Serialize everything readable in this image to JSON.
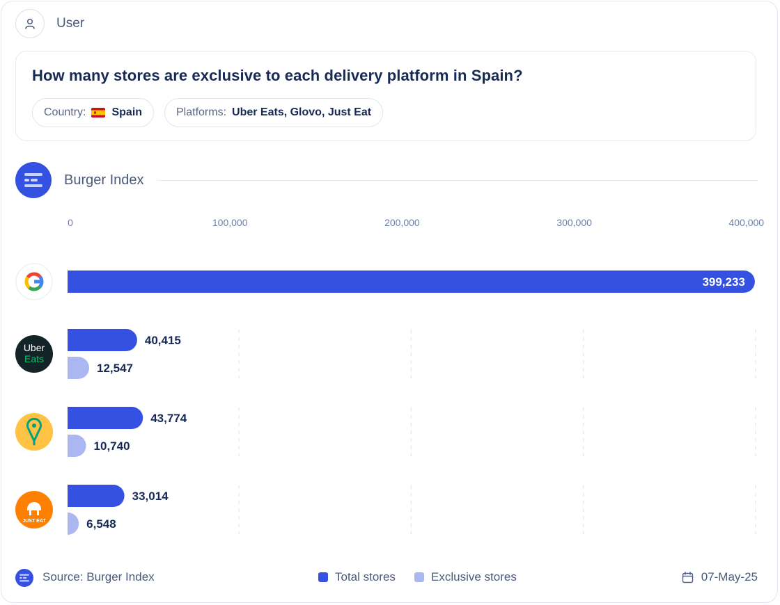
{
  "user": {
    "label": "User",
    "icon": "user-icon"
  },
  "question": {
    "text": "How many stores are exclusive to each delivery platform in Spain?",
    "filters": [
      {
        "key": "Country:",
        "value": "Spain",
        "icon": "spain-flag-icon"
      },
      {
        "key": "Platforms:",
        "value": "Uber Eats, Glovo, Just Eat"
      }
    ]
  },
  "brand": {
    "label": "Burger Index",
    "icon": "burger-index-icon"
  },
  "colors": {
    "total": "#3551e2",
    "exclusive": "#aab7f1",
    "text": "#172a55",
    "axis": "#6d7fa6"
  },
  "chart_data": {
    "type": "bar",
    "orientation": "horizontal",
    "categories": [
      "Google",
      "Uber Eats",
      "Glovo",
      "Just Eat"
    ],
    "x_ticks": [
      "0",
      "100,000",
      "200,000",
      "300,000",
      "400,000"
    ],
    "xlim": [
      0,
      400000
    ],
    "grid": true,
    "series": [
      {
        "name": "Total stores",
        "values": [
          399233,
          40415,
          43774,
          33014
        ],
        "labels": [
          "399,233",
          "40,415",
          "43,774",
          "33,014"
        ]
      },
      {
        "name": "Exclusive stores",
        "values": [
          null,
          12547,
          10740,
          6548
        ],
        "labels": [
          "",
          "12,547",
          "10,740",
          "6,548"
        ]
      }
    ],
    "category_icons": [
      "google-logo-icon",
      "uber-eats-logo-icon",
      "glovo-logo-icon",
      "just-eat-logo-icon"
    ],
    "legend_placement": "bottom"
  },
  "footer": {
    "source": "Source: Burger Index",
    "legend": [
      {
        "name": "Total stores"
      },
      {
        "name": "Exclusive stores"
      }
    ],
    "date": "07-May-25"
  }
}
